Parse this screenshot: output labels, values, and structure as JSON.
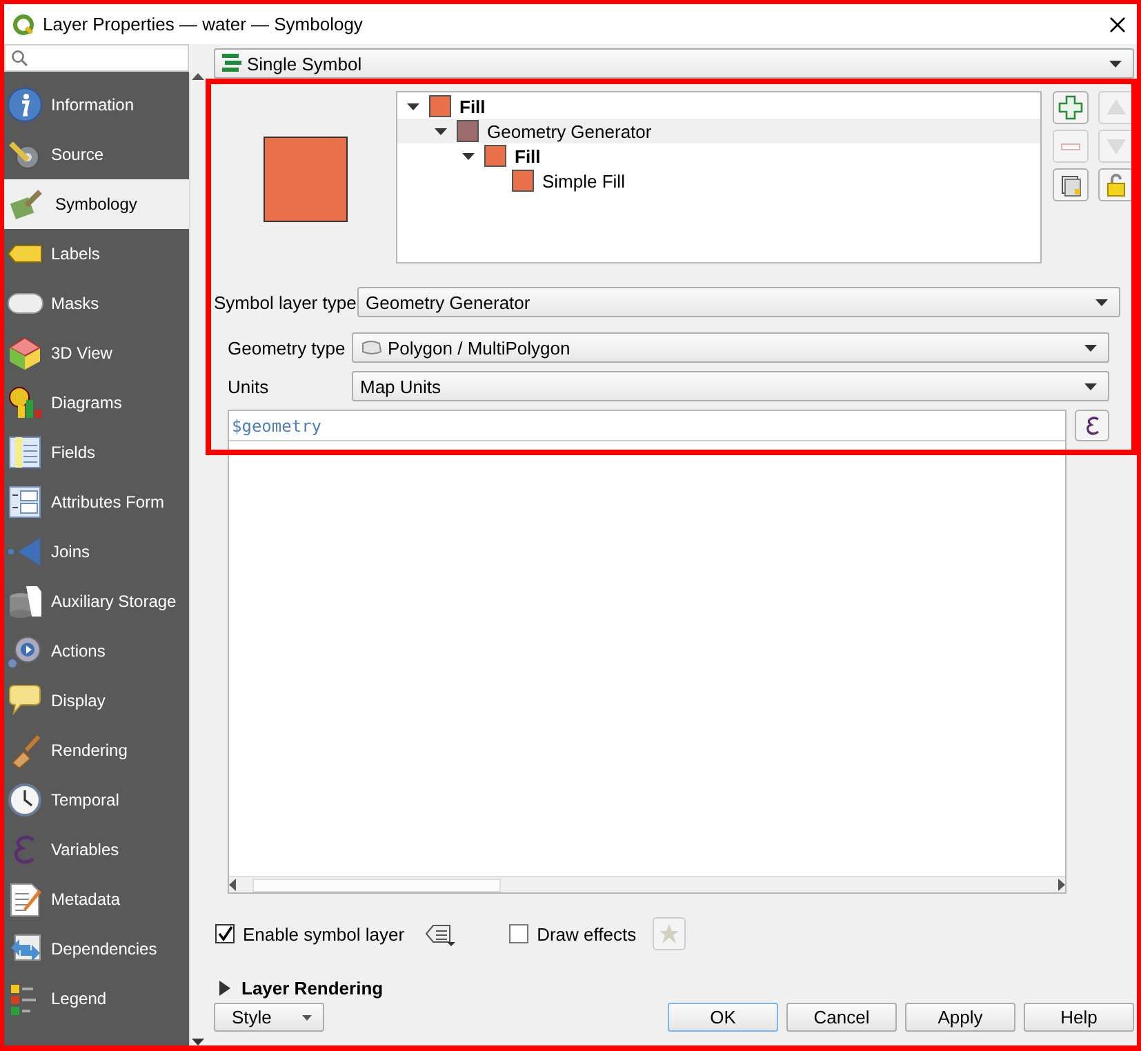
{
  "window": {
    "title": "Layer Properties — water — Symbology"
  },
  "sidebar": {
    "items": [
      {
        "label": "Information",
        "selected": false
      },
      {
        "label": "Source",
        "selected": false
      },
      {
        "label": "Symbology",
        "selected": true
      },
      {
        "label": "Labels",
        "selected": false
      },
      {
        "label": "Masks",
        "selected": false
      },
      {
        "label": "3D View",
        "selected": false
      },
      {
        "label": "Diagrams",
        "selected": false
      },
      {
        "label": "Fields",
        "selected": false
      },
      {
        "label": "Attributes Form",
        "selected": false
      },
      {
        "label": "Joins",
        "selected": false
      },
      {
        "label": "Auxiliary Storage",
        "selected": false
      },
      {
        "label": "Actions",
        "selected": false
      },
      {
        "label": "Display",
        "selected": false
      },
      {
        "label": "Rendering",
        "selected": false
      },
      {
        "label": "Temporal",
        "selected": false
      },
      {
        "label": "Variables",
        "selected": false
      },
      {
        "label": "Metadata",
        "selected": false
      },
      {
        "label": "Dependencies",
        "selected": false
      },
      {
        "label": "Legend",
        "selected": false
      }
    ]
  },
  "renderer": {
    "value": "Single Symbol"
  },
  "symbol": {
    "color": "#e8714a",
    "tree": [
      {
        "label": "Fill",
        "kind": "symbol",
        "color": "#e8714a",
        "expanded": true,
        "selected": false,
        "children": [
          {
            "label": "Geometry Generator",
            "kind": "layer",
            "color": "#9c6b6b",
            "expanded": true,
            "selected": true,
            "children": [
              {
                "label": "Fill",
                "kind": "symbol",
                "color": "#e8714a",
                "expanded": true,
                "selected": false,
                "children": [
                  {
                    "label": "Simple Fill",
                    "kind": "layer",
                    "color": "#e8714a",
                    "selected": false
                  }
                ]
              }
            ]
          }
        ]
      }
    ],
    "tool_buttons": [
      {
        "kind": "add",
        "disabled": false
      },
      {
        "kind": "up",
        "disabled": true
      },
      {
        "kind": "remove",
        "disabled": true
      },
      {
        "kind": "down",
        "disabled": true
      },
      {
        "kind": "duplicate",
        "disabled": false
      },
      {
        "kind": "lock",
        "disabled": false
      }
    ]
  },
  "symbol_layer_type": {
    "label": "Symbol layer type",
    "value": "Geometry Generator"
  },
  "geometry_type": {
    "label": "Geometry type",
    "value": "Polygon / MultiPolygon"
  },
  "units": {
    "label": "Units",
    "value": "Map Units"
  },
  "expression": "$geometry",
  "enable_layer": {
    "label": "Enable symbol layer",
    "checked": true
  },
  "draw_effects": {
    "label": "Draw effects",
    "checked": false
  },
  "layer_rendering": {
    "label": "Layer Rendering",
    "expanded": false
  },
  "buttons": [
    {
      "label": "Style",
      "kind": "menu"
    },
    {
      "label": "OK",
      "kind": "default"
    },
    {
      "label": "Cancel",
      "kind": "plain"
    },
    {
      "label": "Apply",
      "kind": "plain"
    },
    {
      "label": "Help",
      "kind": "plain"
    }
  ]
}
